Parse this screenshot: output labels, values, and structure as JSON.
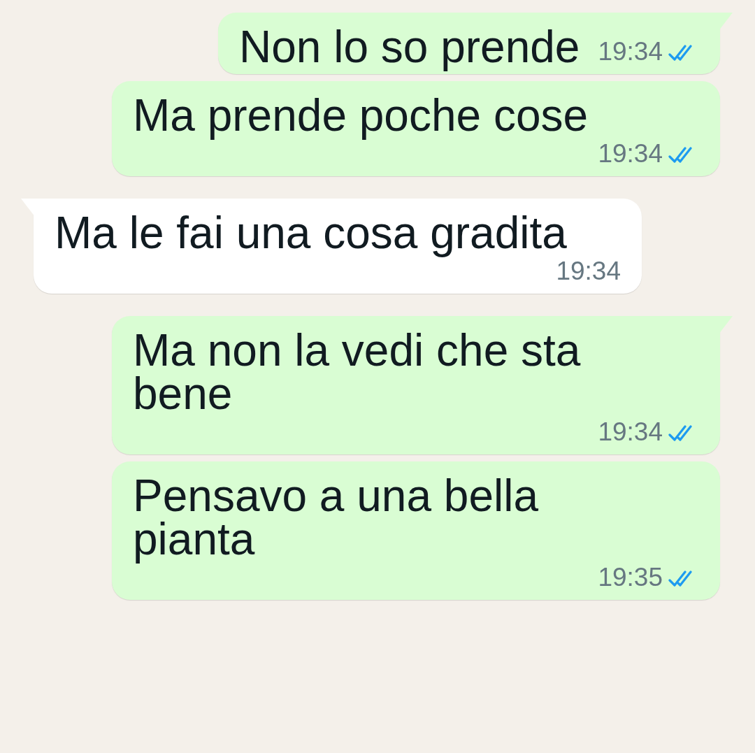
{
  "messages": [
    {
      "kind": "outgoing",
      "text": "Non lo so prende",
      "time": "19:34",
      "read": true,
      "tail": true
    },
    {
      "kind": "outgoing",
      "text": "Ma prende poche cose",
      "time": "19:34",
      "read": true,
      "tail": false
    },
    {
      "kind": "incoming",
      "text": "Ma le fai una cosa gradita",
      "time": "19:34",
      "tail": true
    },
    {
      "kind": "outgoing",
      "text": "Ma non la vedi che sta bene",
      "time": "19:34",
      "read": true,
      "tail": true
    },
    {
      "kind": "outgoing",
      "text": "Pensavo a una bella pianta",
      "time": "19:35",
      "read": true,
      "tail": false
    }
  ]
}
